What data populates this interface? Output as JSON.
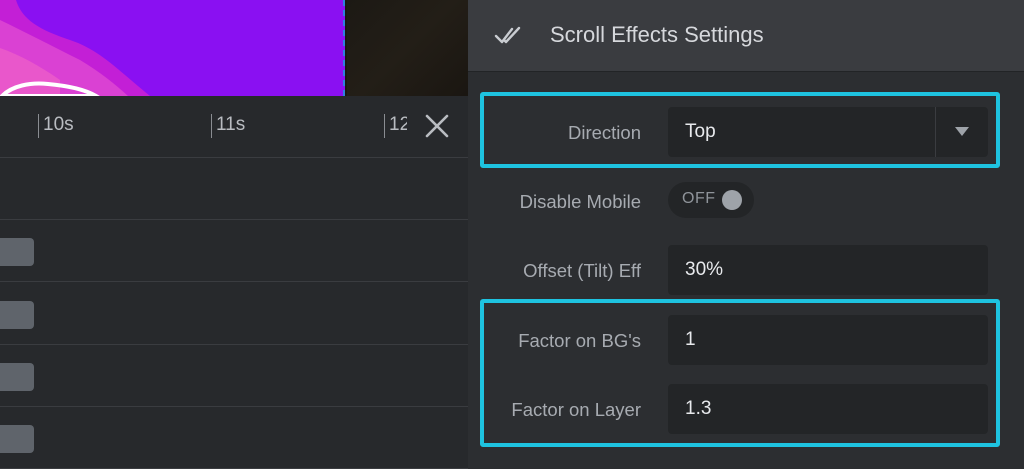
{
  "timeline": {
    "ticks": [
      "10s",
      "11s",
      "12"
    ]
  },
  "panel": {
    "title": "Scroll Effects Settings",
    "direction": {
      "label": "Direction",
      "value": "Top"
    },
    "disable_mobile": {
      "label": "Disable Mobile",
      "value": "OFF"
    },
    "offset": {
      "label": "Offset (Tilt) Eff",
      "value": "30%"
    },
    "factor_bg": {
      "label": "Factor on BG's",
      "value": "1"
    },
    "factor_layers": {
      "label": "Factor on Layer",
      "value": "1.3"
    }
  },
  "colors": {
    "highlight": "#1ec3e0",
    "slide_background": "#8a10f2",
    "panel_background": "#2c2e31"
  },
  "icons": [
    "double-check-icon",
    "close-icon",
    "chevron-down-icon"
  ]
}
